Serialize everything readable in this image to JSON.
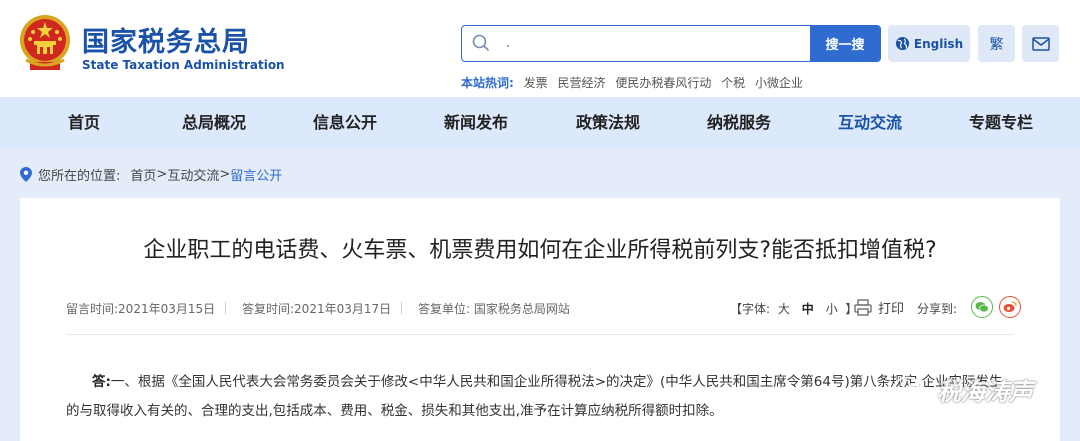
{
  "header": {
    "site_name_cn": "国家税务总局",
    "site_name_en": "State Taxation Administration",
    "search": {
      "value": ".",
      "button_label": "搜一搜"
    },
    "lang_label": "English",
    "trad_label": "繁",
    "hot": {
      "label": "本站热词:",
      "items": [
        "发票",
        "民营经济",
        "便民办税春风行动",
        "个税",
        "小微企业"
      ]
    }
  },
  "nav": {
    "items": [
      {
        "label": "首页"
      },
      {
        "label": "总局概况"
      },
      {
        "label": "信息公开"
      },
      {
        "label": "新闻发布"
      },
      {
        "label": "政策法规"
      },
      {
        "label": "纳税服务"
      },
      {
        "label": "互动交流"
      },
      {
        "label": "专题专栏"
      }
    ],
    "active_index": 6
  },
  "breadcrumb": {
    "prefix": "您所在的位置:",
    "home": "首页",
    "sep": ">",
    "section": "互动交流",
    "current": "留言公开"
  },
  "article": {
    "title": "企业职工的电话费、火车票、机票费用如何在企业所得税前列支?能否抵扣增值税?",
    "message_time": "留言时间:2021年03月15日",
    "reply_time": "答复时间:2021年03月17日",
    "reply_unit": "答复单位: 国家税务总局网站",
    "font_size": {
      "label": "【字体:",
      "large": "大",
      "medium": "中",
      "small": "小",
      "close": "】"
    },
    "print_label": "打印",
    "share_label": "分享到:",
    "answer_lead": "答:",
    "answer_text": "一、根据《全国人民代表大会常务委员会关于修改<中华人民共和国企业所得税法>的决定》(中华人民共和国主席令第64号)第八条规定,企业实际发生的与取得收入有关的、合理的支出,包括成本、费用、税金、损失和其他支出,准予在计算应纳税所得额时扣除。"
  },
  "watermark": {
    "text": "税海涛声"
  },
  "colors": {
    "brand_blue": "#1a52a8",
    "accent_blue": "#2f6bd0",
    "nav_bg": "#dce8fb"
  }
}
